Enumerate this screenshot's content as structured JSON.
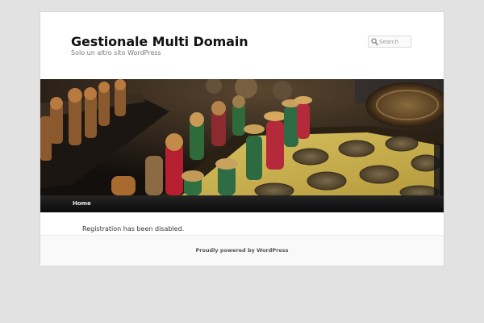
{
  "site": {
    "title": "Gestionale Multi Domain",
    "description": "Solo un altro sito WordPress"
  },
  "search": {
    "placeholder": "Search",
    "icon": "search-icon"
  },
  "header_image": {
    "subject": "chess-pieces-photo"
  },
  "nav": {
    "items": [
      {
        "label": "Home"
      }
    ]
  },
  "content": {
    "message": "Registration has been disabled."
  },
  "footer": {
    "credit": "Proudly powered by WordPress"
  },
  "colors": {
    "page_background": "#e2e2e2",
    "nav_background": "#111111",
    "footer_background": "#f9f9f9"
  }
}
